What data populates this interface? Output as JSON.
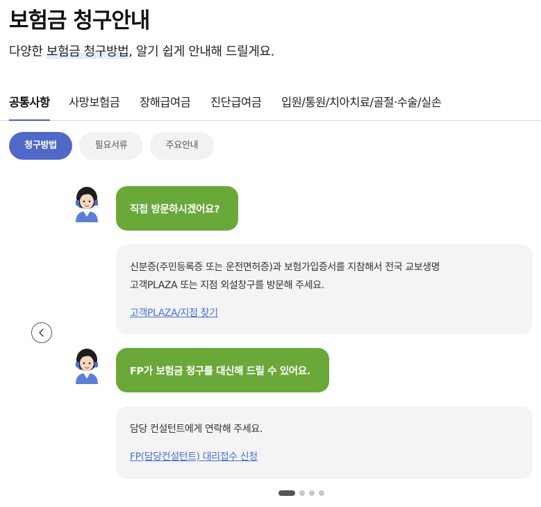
{
  "header": {
    "title": "보험금 청구안내",
    "subtitle_pre": "다양한 ",
    "subtitle_highlight": "보험금 청구방법",
    "subtitle_post": ", 알기 쉽게 안내해 드릴게요."
  },
  "tabs": [
    {
      "label": "공통사항",
      "active": true
    },
    {
      "label": "사망보험금"
    },
    {
      "label": "장해급여금"
    },
    {
      "label": "진단급여금"
    },
    {
      "label": "입원/통원/치아치료/골절·수술/실손"
    }
  ],
  "chips": [
    {
      "label": "청구방법",
      "active": true
    },
    {
      "label": "필요서류"
    },
    {
      "label": "주요안내"
    }
  ],
  "conversation": [
    {
      "question": "직접 방문하시겠어요?",
      "answer_lines": [
        "신분증(주민등록증 또는 운전면허증)과 보험가입증서를 지참해서 전국 교보생명",
        "고객PLAZA 또는 지점 외설창구를 방문해 주세요."
      ],
      "link": "고객PLAZA/지점 찾기"
    },
    {
      "question": "FP가 보험금 청구를 대신해 드릴 수 있어요.",
      "answer_lines": [
        "담당 컨설턴트에게 연락해 주세요."
      ],
      "link": "FP(담당컨설턴트) 대리접수 신청"
    }
  ],
  "carousel": {
    "pages": 4,
    "current": 1
  },
  "icons": {
    "prev": "chevron-left-icon",
    "avatar": "agent-avatar-icon"
  },
  "colors": {
    "accent": "#5068c8",
    "question_bubble": "#6aa83a",
    "answer_bubble": "#f4f4f4",
    "link": "#4a6fd8"
  }
}
